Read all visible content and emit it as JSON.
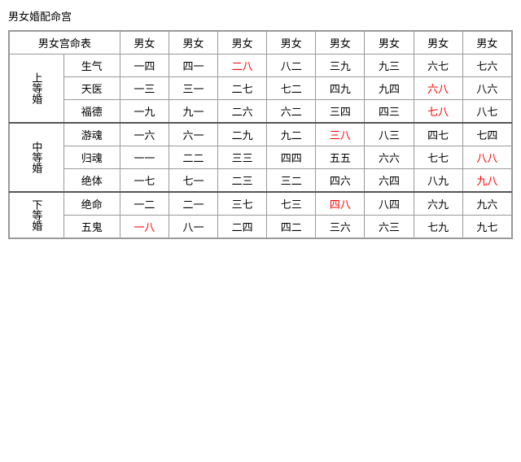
{
  "title": "男女婚配命宫",
  "headers": {
    "col1": "男女宫命表",
    "cols": [
      "男女",
      "男女",
      "男女",
      "男女",
      "男女",
      "男女",
      "男女",
      "男女"
    ]
  },
  "groups": [
    {
      "groupLabel": "上等婚",
      "rows": [
        {
          "subLabel": "生气",
          "cells": [
            "一四",
            "四一",
            "二八",
            "八二",
            "三九",
            "九三",
            "六七",
            "七六"
          ],
          "redCells": [
            2
          ]
        },
        {
          "subLabel": "天医",
          "cells": [
            "一三",
            "三一",
            "二七",
            "七二",
            "四九",
            "九四",
            "六八",
            "八六"
          ],
          "redCells": [
            6
          ]
        },
        {
          "subLabel": "福德",
          "cells": [
            "一九",
            "九一",
            "二六",
            "六二",
            "三四",
            "四三",
            "七八",
            "八七"
          ],
          "redCells": [
            6
          ]
        }
      ]
    },
    {
      "groupLabel": "中等婚",
      "rows": [
        {
          "subLabel": "游魂",
          "cells": [
            "一六",
            "六一",
            "二九",
            "九二",
            "三八",
            "八三",
            "四七",
            "七四"
          ],
          "redCells": [
            4
          ]
        },
        {
          "subLabel": "归魂",
          "cells": [
            "一一",
            "二二",
            "三三",
            "四四",
            "五五",
            "六六",
            "七七",
            "八八"
          ],
          "redCells": [
            7
          ]
        },
        {
          "subLabel": "绝体",
          "cells": [
            "一七",
            "七一",
            "二三",
            "三二",
            "四六",
            "六四",
            "八九",
            "九八"
          ],
          "redCells": [
            7
          ]
        }
      ]
    },
    {
      "groupLabel": "下等婚",
      "rows": [
        {
          "subLabel": "绝命",
          "cells": [
            "一二",
            "二一",
            "三七",
            "七三",
            "四八",
            "八四",
            "六九",
            "九六"
          ],
          "redCells": [
            4
          ]
        },
        {
          "subLabel": "五鬼",
          "cells": [
            "一八",
            "八一",
            "二四",
            "四二",
            "三六",
            "六三",
            "七九",
            "九七"
          ],
          "redCells": [
            0
          ]
        }
      ]
    }
  ]
}
